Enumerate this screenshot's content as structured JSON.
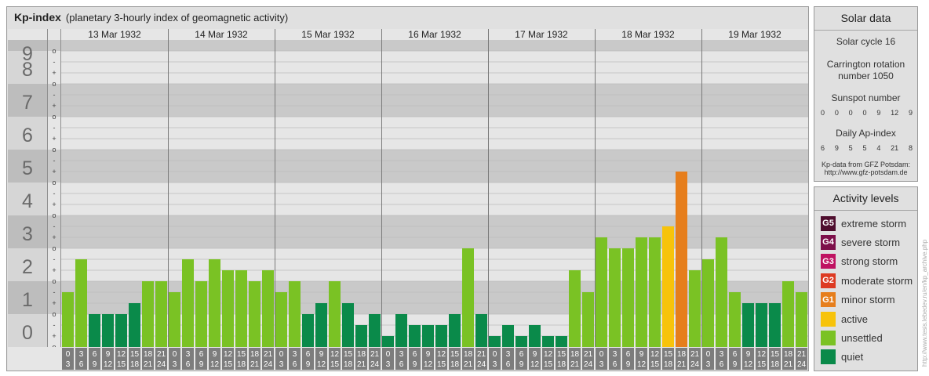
{
  "header": {
    "title": "Kp-index",
    "subtitle": "(planetary 3-hourly index of geomagnetic activity)"
  },
  "chart_data": {
    "type": "bar",
    "y_scale_labels": [
      "0",
      "1",
      "2",
      "3",
      "4",
      "5",
      "6",
      "7",
      "8",
      "9"
    ],
    "sub_tick_labels": [
      "+",
      "o",
      "-"
    ],
    "ylim": [
      0,
      9.33
    ],
    "days": [
      "13 Mar 1932",
      "14 Mar 1932",
      "15 Mar 1932",
      "16 Mar 1932",
      "17 Mar 1932",
      "18 Mar 1932",
      "19 Mar 1932"
    ],
    "interval_top": [
      "0",
      "3",
      "6",
      "9",
      "12",
      "15",
      "18",
      "21"
    ],
    "interval_bottom": [
      "3",
      "6",
      "9",
      "12",
      "15",
      "18",
      "21",
      "24"
    ],
    "values": [
      [
        1.667,
        2.667,
        1.0,
        1.0,
        1.0,
        1.333,
        2.0,
        2.0
      ],
      [
        1.667,
        2.667,
        2.0,
        2.667,
        2.333,
        2.333,
        2.0,
        2.333
      ],
      [
        1.667,
        2.0,
        1.0,
        1.333,
        2.0,
        1.333,
        0.667,
        1.0
      ],
      [
        0.333,
        1.0,
        0.667,
        0.667,
        0.667,
        1.0,
        3.0,
        1.0
      ],
      [
        0.333,
        0.667,
        0.333,
        0.667,
        0.333,
        0.333,
        2.333,
        1.667
      ],
      [
        3.333,
        3.0,
        3.0,
        3.333,
        3.333,
        3.667,
        5.333,
        2.333
      ],
      [
        2.667,
        3.333,
        1.667,
        1.333,
        1.333,
        1.333,
        2.0,
        1.667
      ]
    ],
    "colors": {
      "quiet": "#0a8a4a",
      "unsettled": "#7ac224",
      "active": "#f7c30b",
      "minor": "#e67e1c"
    }
  },
  "solar": {
    "title": "Solar data",
    "cycle": "Solar cycle 16",
    "carrington_line1": "Carrington rotation",
    "carrington_line2": "number 1050",
    "sunspot_label": "Sunspot number",
    "sunspot_values": [
      "0",
      "0",
      "0",
      "0",
      "9",
      "12",
      "9"
    ],
    "ap_label": "Daily Ap-index",
    "ap_values": [
      "6",
      "9",
      "5",
      "5",
      "4",
      "21",
      "8"
    ],
    "source_line1": "Kp-data from GFZ Potsdam:",
    "source_line2": "http://www.gfz-potsdam.de"
  },
  "activity": {
    "title": "Activity levels",
    "levels": [
      {
        "badge": "G5",
        "label": "extreme storm",
        "color": "#4f0e2e"
      },
      {
        "badge": "G4",
        "label": "severe storm",
        "color": "#7d0f4a"
      },
      {
        "badge": "G3",
        "label": "strong storm",
        "color": "#bf1261"
      },
      {
        "badge": "G2",
        "label": "moderate storm",
        "color": "#dd3a22"
      },
      {
        "badge": "G1",
        "label": "minor storm",
        "color": "#e67e1c"
      },
      {
        "badge": "",
        "label": "active",
        "color": "#f7c30b"
      },
      {
        "badge": "",
        "label": "unsettled",
        "color": "#7ac224"
      },
      {
        "badge": "",
        "label": "quiet",
        "color": "#0a8a4a"
      }
    ]
  },
  "credit": "http://www.tesis.lebedev.ru/en/kp_archive.php"
}
